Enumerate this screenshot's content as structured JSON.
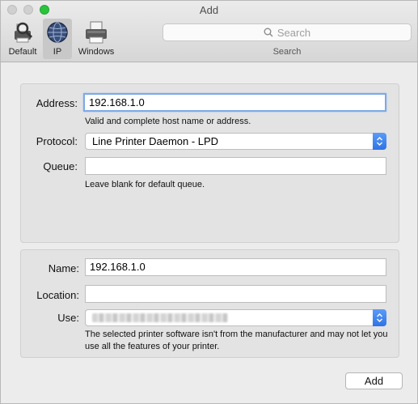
{
  "window": {
    "title": "Add"
  },
  "toolbar": {
    "items": [
      {
        "label": "Default",
        "icon": "default-printer-icon"
      },
      {
        "label": "IP",
        "icon": "globe-icon",
        "selected": true
      },
      {
        "label": "Windows",
        "icon": "windows-printer-icon"
      }
    ],
    "search": {
      "placeholder": "Search",
      "caption": "Search"
    }
  },
  "connection": {
    "address_label": "Address:",
    "address_value": "192.168.1.0",
    "address_hint": "Valid and complete host name or address.",
    "protocol_label": "Protocol:",
    "protocol_value": "Line Printer Daemon - LPD",
    "queue_label": "Queue:",
    "queue_value": "",
    "queue_hint": "Leave blank for default queue."
  },
  "printer": {
    "name_label": "Name:",
    "name_value": "192.168.1.0",
    "location_label": "Location:",
    "location_value": "",
    "use_label": "Use:",
    "use_note": "The selected printer software isn't from the manufacturer and may not let you use all the features of your printer."
  },
  "actions": {
    "add_label": "Add"
  },
  "colors": {
    "accent": "#2f73e6",
    "focus_ring": "#7ea9e6",
    "zoom_button": "#2bc33e"
  }
}
